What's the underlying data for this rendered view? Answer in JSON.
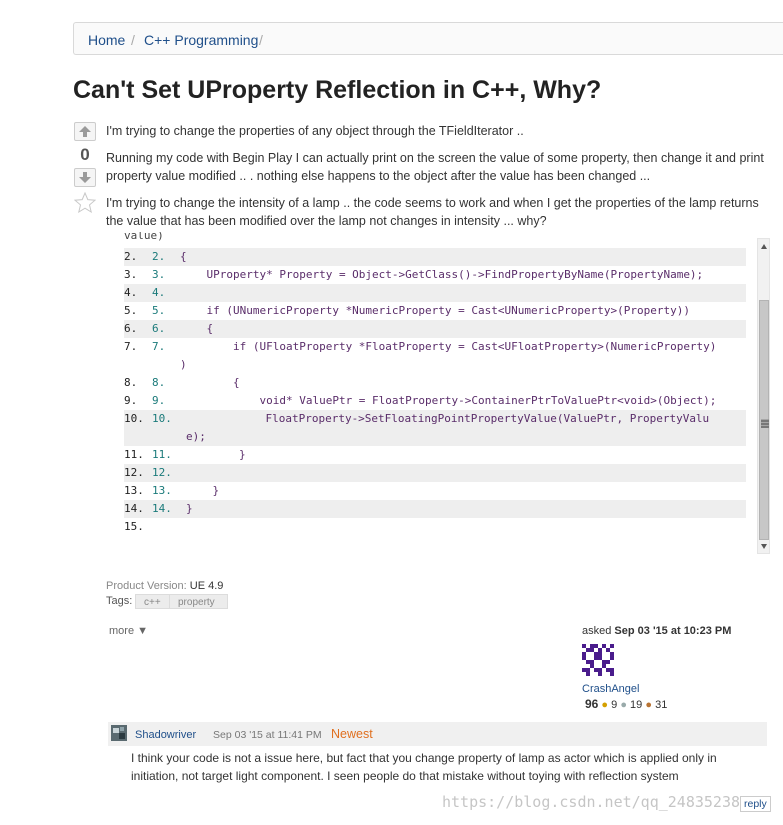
{
  "breadcrumb": {
    "items": [
      "Home",
      "C++ Programming"
    ],
    "separator": "/"
  },
  "question": {
    "title": "Can't Set UProperty Reflection in C++, Why?",
    "vote_count": "0",
    "paragraphs": [
      "I'm trying to change the properties of any object through the TFieldIterator ..",
      "Running my code with Begin Play I can actually print on the screen the value of some property, then change it and print property value modified .. . nothing else happens to the object after the value has been changed ...",
      "I'm trying to change the intensity of a lamp .. the code seems to work and when I get the properties of the lamp returns the value that has been modified over the lamp not changes in intensity ... why?"
    ]
  },
  "code": {
    "partial_top": "value)",
    "lines": [
      {
        "n1": "2.",
        "n2": "2.",
        "text": "{"
      },
      {
        "n1": "3.",
        "n2": "3.",
        "text": "    UProperty* Property = Object->GetClass()->FindPropertyByName(PropertyName);"
      },
      {
        "n1": "4.",
        "n2": "4.",
        "text": ""
      },
      {
        "n1": "5.",
        "n2": "5.",
        "text": "    if (UNumericProperty *NumericProperty = Cast<UNumericProperty>(Property))"
      },
      {
        "n1": "6.",
        "n2": "6.",
        "text": "    {"
      },
      {
        "n1": "7.",
        "n2": "7.",
        "text": "        if (UFloatProperty *FloatProperty = Cast<UFloatProperty>(NumericProperty)"
      },
      {
        "n1": "",
        "n2": "",
        "text": ")"
      },
      {
        "n1": "8.",
        "n2": "8.",
        "text": "        {"
      },
      {
        "n1": "9.",
        "n2": "9.",
        "text": "            void* ValuePtr = FloatProperty->ContainerPtrToValuePtr<void>(Object);"
      },
      {
        "n1": "10.",
        "n2": "10.",
        "text": "            FloatProperty->SetFloatingPointPropertyValue(ValuePtr, PropertyValu"
      },
      {
        "n1": "",
        "n2": "",
        "text": "e);"
      },
      {
        "n1": "11.",
        "n2": "11.",
        "text": "        }"
      },
      {
        "n1": "12.",
        "n2": "12.",
        "text": ""
      },
      {
        "n1": "13.",
        "n2": "13.",
        "text": "    }"
      },
      {
        "n1": "14.",
        "n2": "14.",
        "text": "}"
      },
      {
        "n1": "15.",
        "n2": "",
        "text": ""
      }
    ]
  },
  "meta": {
    "product_version_label": "Product Version:",
    "product_version": "UE 4.9",
    "tags_label": "Tags:",
    "tags": [
      "c++",
      "property"
    ],
    "more_label": "more ▼",
    "asked_prefix": "asked",
    "asked_date": "Sep 03 '15 at 10:23 PM",
    "user_name": "CrashAngel",
    "user_rep": "96",
    "user_gold": "9",
    "user_silver": "19",
    "user_bronze": "31"
  },
  "comment": {
    "author": "Shadowriver",
    "date": "Sep 03 '15 at 11:41 PM",
    "badge": "Newest",
    "body": "I think your code is not a issue here, but fact that you change property of lamp as actor which is applied only in initiation, not target light component. I seen people do that mistake without toying with reflection system",
    "reply_label": "reply"
  },
  "watermark": "https://blog.csdn.net/qq_24835238",
  "colors": {
    "link": "#1f4f8a",
    "badge": "#e07020",
    "code_shade": "#eeeeee"
  }
}
